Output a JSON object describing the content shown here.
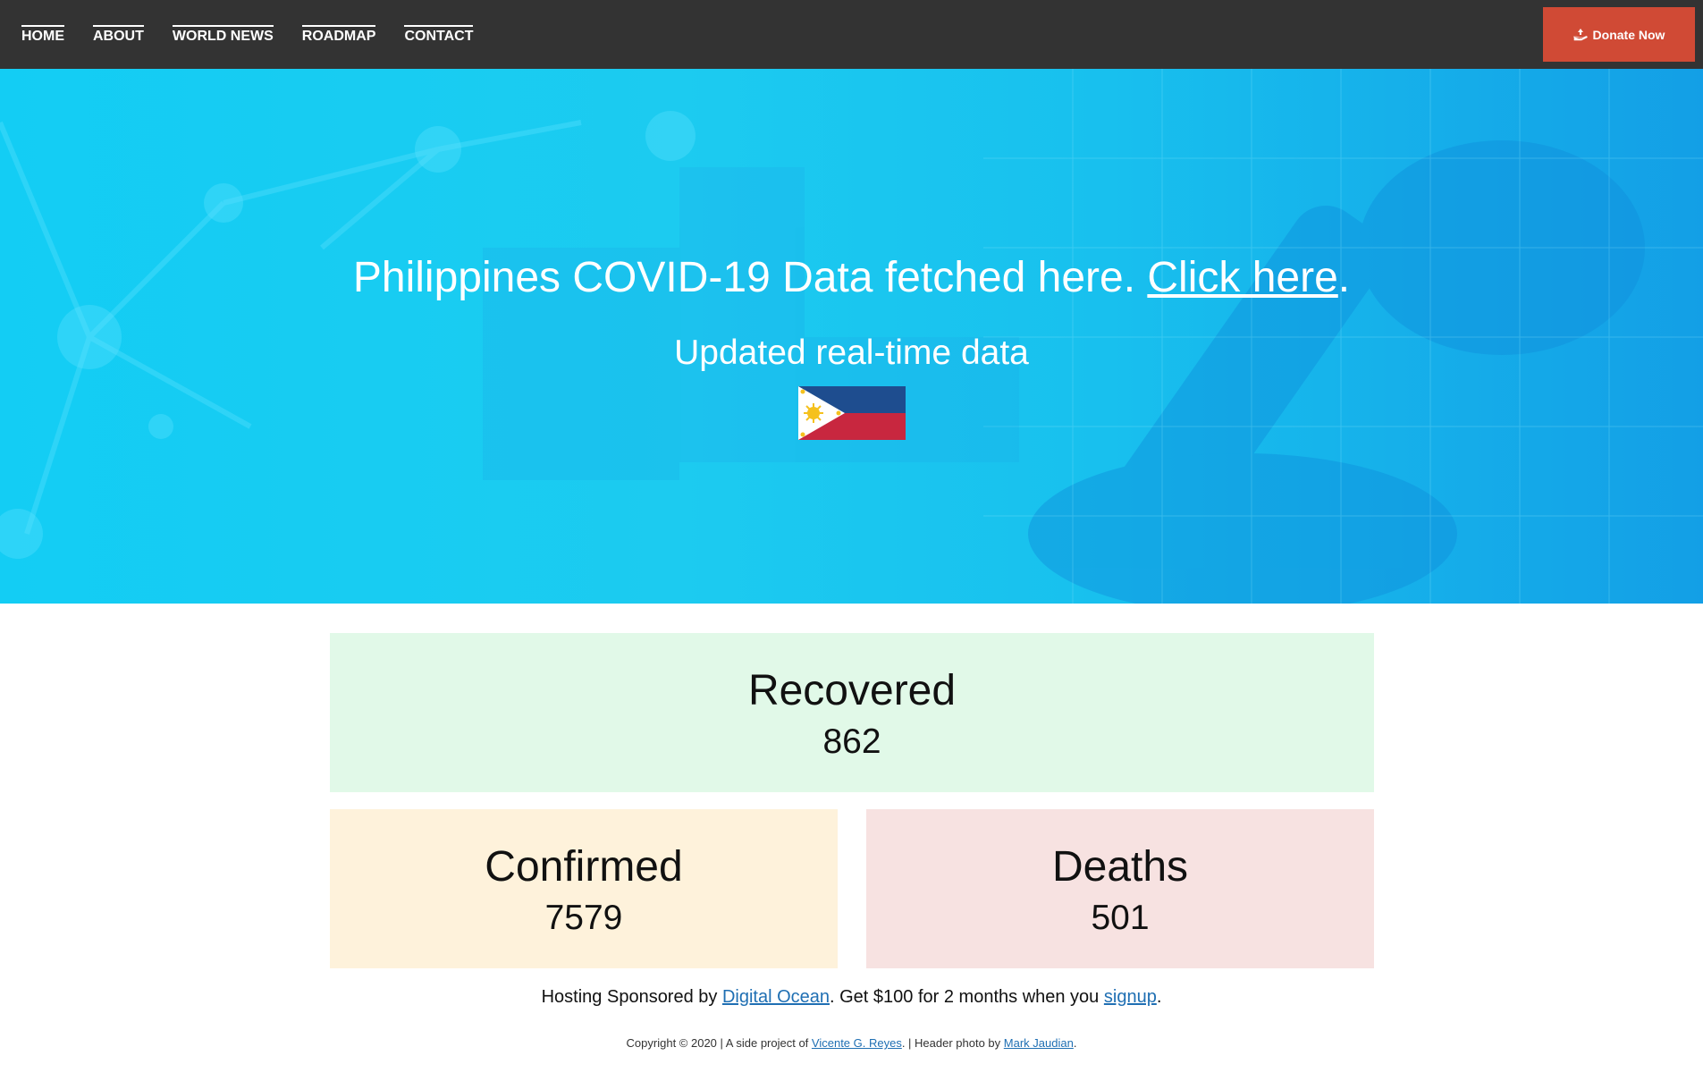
{
  "nav": {
    "links": [
      "HOME",
      "ABOUT",
      "WORLD NEWS",
      "ROADMAP",
      "CONTACT"
    ],
    "donate_label": "Donate Now",
    "donate_color": "#d04a35",
    "background": "#333333"
  },
  "hero": {
    "title_text": "Philippines COVID-19 Data fetched here. ",
    "title_link": "Click here",
    "title_end": ".",
    "subtitle": "Updated real-time data",
    "flag_icon": "philippines-flag-icon"
  },
  "stats": {
    "recovered": {
      "label": "Recovered",
      "value": "862",
      "color": "#e1f9e8"
    },
    "confirmed": {
      "label": "Confirmed",
      "value": "7579",
      "color": "#fef2db"
    },
    "deaths": {
      "label": "Deaths",
      "value": "501",
      "color": "#f7e2e1"
    }
  },
  "sponsor": {
    "text1": "Hosting Sponsored by ",
    "link1": "Digital Ocean",
    "text2": ". Get $100 for 2 months when you ",
    "link2": "signup",
    "text3": "."
  },
  "footer": {
    "text1": "Copyright © 2020 | A side project of ",
    "link1": "Vicente G. Reyes",
    "text2": ". | Header photo by ",
    "link2": "Mark Jaudian",
    "text3": "."
  }
}
